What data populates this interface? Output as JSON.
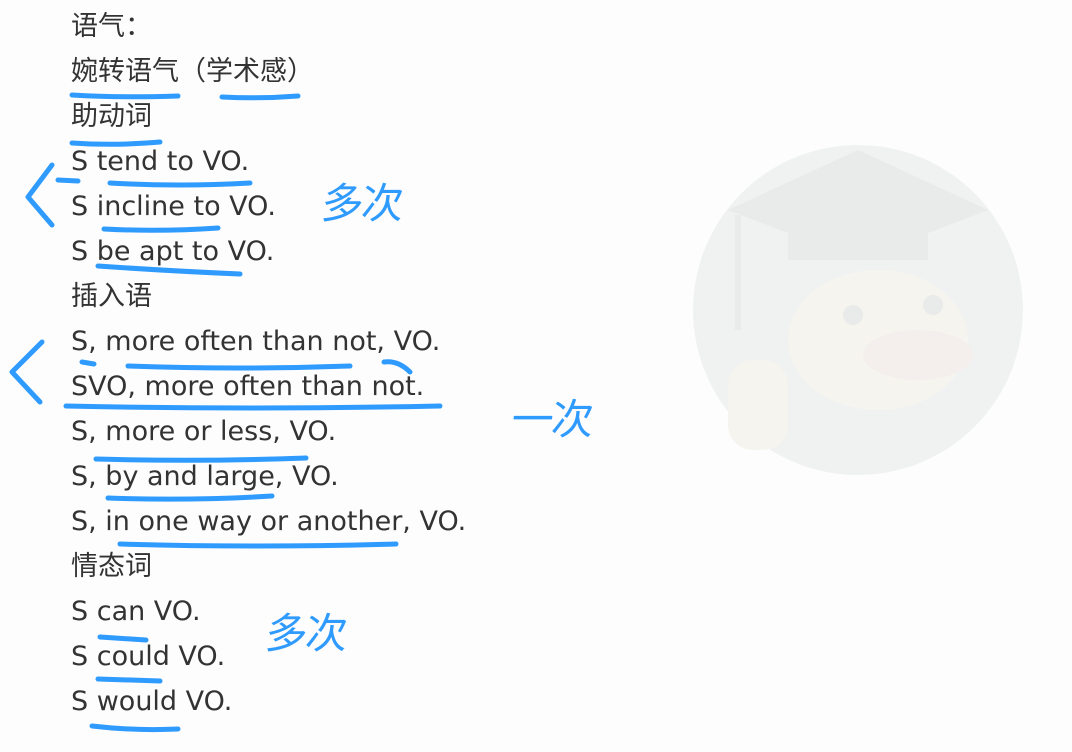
{
  "lines": [
    "语气：",
    "婉转语气（学术感）",
    "助动词",
    "S tend to VO.",
    "S incline to VO.",
    "S be apt to VO.",
    "插入语",
    "S, more often than not, VO.",
    "SVO, more often than not.",
    "S, more or less, VO.",
    "S, by and large, VO.",
    "S, in one way or another, VO.",
    "情态词",
    "S can VO.",
    "S could VO.",
    "S would VO."
  ],
  "annotations": {
    "auxiliary_note": "多次",
    "insertion_note": "一次",
    "modal_note": "多次"
  },
  "colors": {
    "ink": "#2f9bff",
    "text": "#333333",
    "background": "#fdfdfd"
  },
  "watermark": "duck-mascot-with-graduation-cap"
}
